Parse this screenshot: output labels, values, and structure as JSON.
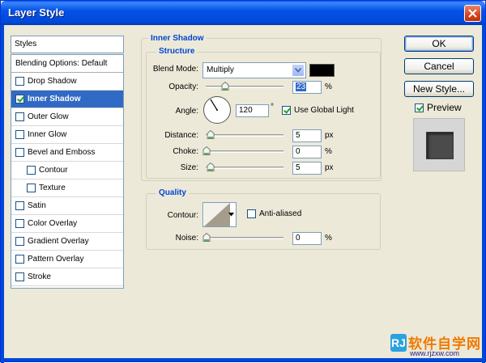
{
  "window": {
    "title": "Layer Style"
  },
  "styles_panel": {
    "header": "Styles",
    "items": [
      {
        "label": "Blending Options: Default",
        "checkbox": false,
        "checked": false,
        "indent": false,
        "selected": false
      },
      {
        "label": "Drop Shadow",
        "checkbox": true,
        "checked": false,
        "indent": false,
        "selected": false
      },
      {
        "label": "Inner Shadow",
        "checkbox": true,
        "checked": true,
        "indent": false,
        "selected": true
      },
      {
        "label": "Outer Glow",
        "checkbox": true,
        "checked": false,
        "indent": false,
        "selected": false
      },
      {
        "label": "Inner Glow",
        "checkbox": true,
        "checked": false,
        "indent": false,
        "selected": false
      },
      {
        "label": "Bevel and Emboss",
        "checkbox": true,
        "checked": false,
        "indent": false,
        "selected": false
      },
      {
        "label": "Contour",
        "checkbox": true,
        "checked": false,
        "indent": true,
        "selected": false
      },
      {
        "label": "Texture",
        "checkbox": true,
        "checked": false,
        "indent": true,
        "selected": false
      },
      {
        "label": "Satin",
        "checkbox": true,
        "checked": false,
        "indent": false,
        "selected": false
      },
      {
        "label": "Color Overlay",
        "checkbox": true,
        "checked": false,
        "indent": false,
        "selected": false
      },
      {
        "label": "Gradient Overlay",
        "checkbox": true,
        "checked": false,
        "indent": false,
        "selected": false
      },
      {
        "label": "Pattern Overlay",
        "checkbox": true,
        "checked": false,
        "indent": false,
        "selected": false
      },
      {
        "label": "Stroke",
        "checkbox": true,
        "checked": false,
        "indent": false,
        "selected": false
      }
    ]
  },
  "inner_shadow": {
    "section_title": "Inner Shadow",
    "structure": {
      "title": "Structure",
      "blend_mode_label": "Blend Mode:",
      "blend_mode_value": "Multiply",
      "shadow_color": "#000000",
      "opacity_label": "Opacity:",
      "opacity_value": "23",
      "opacity_unit": "%",
      "angle_label": "Angle:",
      "angle_value": "120",
      "angle_unit": "°",
      "use_global_light_label": "Use Global Light",
      "use_global_light_checked": true,
      "distance_label": "Distance:",
      "distance_value": "5",
      "distance_unit": "px",
      "choke_label": "Choke:",
      "choke_value": "0",
      "choke_unit": "%",
      "size_label": "Size:",
      "size_value": "5",
      "size_unit": "px"
    },
    "quality": {
      "title": "Quality",
      "contour_label": "Contour:",
      "anti_aliased_label": "Anti-aliased",
      "anti_aliased_checked": false,
      "noise_label": "Noise:",
      "noise_value": "0",
      "noise_unit": "%"
    }
  },
  "buttons": {
    "ok": "OK",
    "cancel": "Cancel",
    "new_style": "New Style...",
    "preview_label": "Preview",
    "preview_checked": true
  },
  "watermark": {
    "text": "软件自学网",
    "url": "www.rjzxw.com",
    "logo": "RJ"
  },
  "colors": {
    "title_bar": "#0453e6",
    "selection": "#316ac5",
    "legend_text": "#0046d5",
    "dialog_bg": "#ece9d8",
    "preview_swatch": "#4b4b4b"
  }
}
